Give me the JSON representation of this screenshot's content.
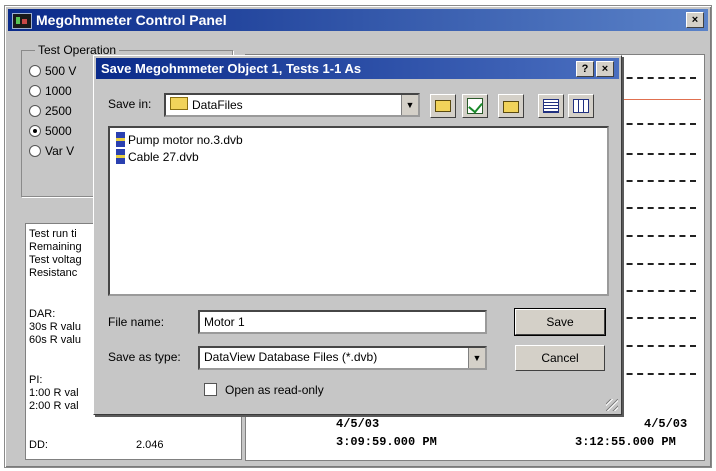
{
  "window": {
    "title": "Megohmmeter Control Panel",
    "close": "×"
  },
  "test_operation": {
    "legend": "Test Operation",
    "options": [
      "500 V",
      "1000",
      "2500",
      "5000",
      "Var V"
    ],
    "selected_index": 3
  },
  "info": {
    "lines": [
      "Test run ti",
      "Remaining",
      "Test voltag",
      "Resistanc",
      "DAR:",
      "30s R valu",
      "60s R valu",
      "PI:",
      "1:00 R val",
      "2:00 R val"
    ],
    "dd_label": "DD:",
    "dd_value": "2.046"
  },
  "chart": {
    "start_date": "4/5/03",
    "start_time": "3:09:59.000 PM",
    "end_date": "4/5/03",
    "end_time": "3:12:55.000 PM",
    "accent_line_color": "#e07050"
  },
  "dialog": {
    "title": "Save Megohmmeter Object 1, Tests 1-1 As",
    "help": "?",
    "close": "×",
    "save_in_label": "Save in:",
    "save_in_value": "DataFiles",
    "files": [
      "Pump motor no.3.dvb",
      "Cable 27.dvb"
    ],
    "file_name_label": "File name:",
    "file_name_value": "Motor 1",
    "save_as_type_label": "Save as type:",
    "save_as_type_value": "DataView Database Files (*.dvb)",
    "save_button": "Save",
    "cancel_button": "Cancel",
    "read_only_label": "Open as read-only"
  }
}
